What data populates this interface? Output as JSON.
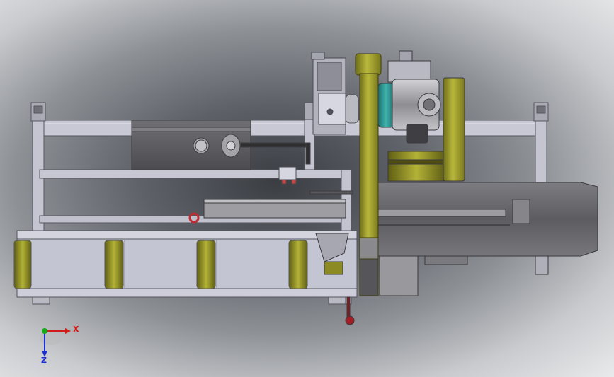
{
  "view": {
    "background": "gradient-gray",
    "colors": {
      "frame": "#c9cad6",
      "frame_dark": "#6a6b74",
      "roller": "#8b8a23",
      "housing": "#5d5d60",
      "motor": "#a9a9ad",
      "accent_teal": "#2c8a86",
      "handle_red": "#8e1d22"
    }
  },
  "triad": {
    "x_label": "X",
    "z_label": "Z",
    "x_color": "#d11a1a",
    "y_color": "#18a818",
    "z_color": "#1a2fd1"
  }
}
